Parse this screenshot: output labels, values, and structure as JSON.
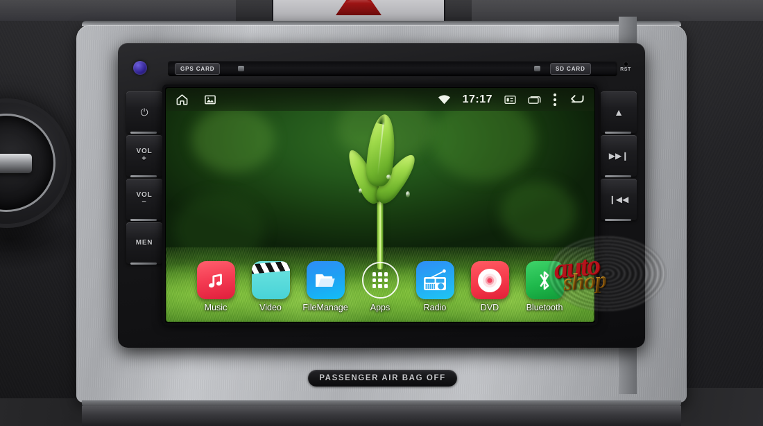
{
  "device": {
    "name": "Car Android Head Unit",
    "slot_labels": {
      "gps": "GPS CARD",
      "sd": "SD CARD"
    },
    "reset_label": "RST",
    "left_buttons": [
      {
        "id": "power",
        "label": "",
        "icon": "power-icon",
        "glyph": "⏻"
      },
      {
        "id": "vol-up",
        "label": "VOL",
        "sub": "+",
        "icon": "volume-up-icon"
      },
      {
        "id": "vol-down",
        "label": "VOL",
        "sub": "−",
        "icon": "volume-down-icon"
      },
      {
        "id": "menu",
        "label": "MEN",
        "sub": "",
        "icon": "menu-button-icon"
      }
    ],
    "right_buttons": [
      {
        "id": "eject",
        "label": "",
        "icon": "eject-icon",
        "glyph": "▲"
      },
      {
        "id": "next-track",
        "label": "",
        "icon": "next-track-icon",
        "glyph": "▶▶|"
      },
      {
        "id": "prev-track",
        "label": "",
        "icon": "previous-track-icon",
        "glyph": "|◀◀"
      }
    ]
  },
  "statusbar": {
    "home_icon": "home-icon",
    "gallery_icon": "gallery-icon",
    "wifi_icon": "wifi-icon",
    "time": "17:17",
    "screenshot_icon": "screenshot-icon",
    "recents_icon": "recent-apps-icon",
    "overflow_icon": "overflow-menu-icon",
    "back_icon": "back-arrow-icon"
  },
  "wallpaper": {
    "description": "green sprout seedling over moss",
    "background_color": "#2a6620",
    "moss_color": "#76be38"
  },
  "dock": {
    "apps": [
      {
        "label": "Music",
        "icon": "music-note-icon",
        "color": "#f43b52"
      },
      {
        "label": "Video",
        "icon": "clapperboard-icon",
        "color": "#48d3d7"
      },
      {
        "label": "FileManage",
        "icon": "folder-icon",
        "color": "#1f9ff3"
      },
      {
        "label": "Apps",
        "icon": "app-drawer-icon",
        "color": "#ffffff"
      },
      {
        "label": "Radio",
        "icon": "radio-icon",
        "color": "#25a6f4"
      },
      {
        "label": "DVD",
        "icon": "disc-icon",
        "color": "#f63c4c"
      },
      {
        "label": "Bluetooth",
        "icon": "bluetooth-icon",
        "color": "#1fb94c"
      }
    ]
  },
  "dashboard": {
    "hazard_button_icon": "hazard-triangle-icon",
    "airbag_indicator": "PASSENGER AIR BAG OFF",
    "vent_icon": "air-vent-icon"
  },
  "watermark": {
    "line1": "auto",
    "line2": "shop"
  }
}
